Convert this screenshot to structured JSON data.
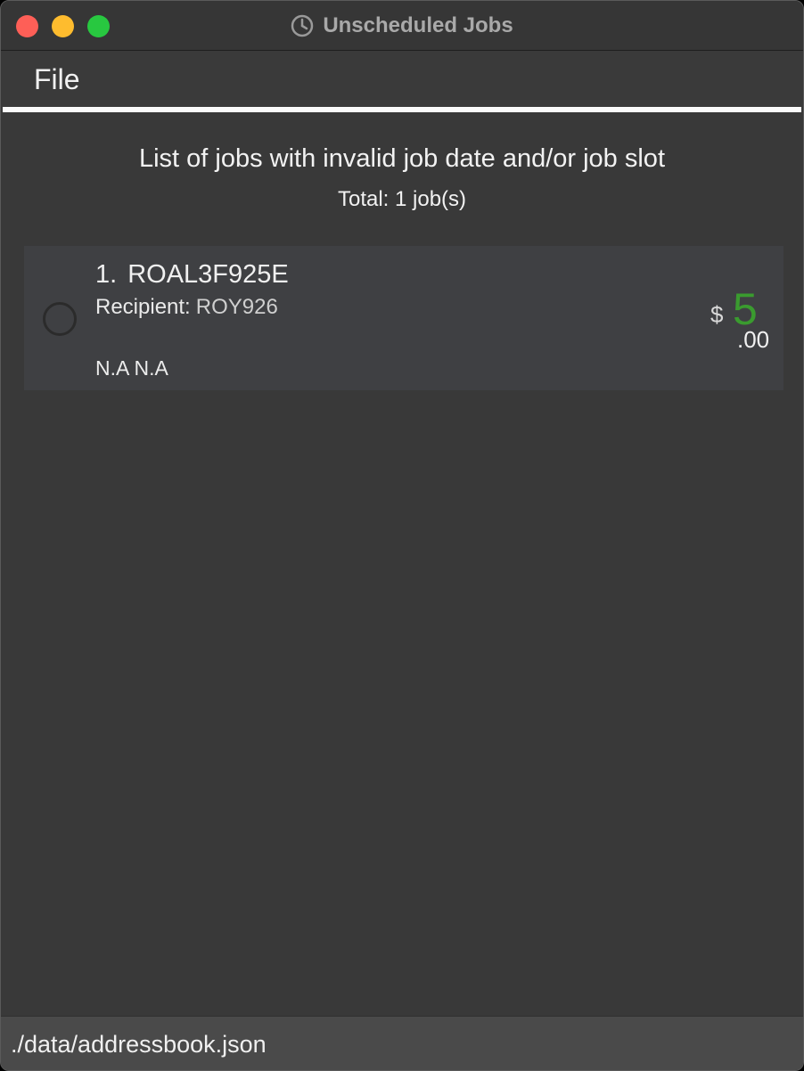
{
  "window": {
    "title": "Unscheduled Jobs",
    "title_icon": "clock-icon",
    "controls": [
      "close-button",
      "minimize-button",
      "maximize-button"
    ]
  },
  "menu": {
    "items": [
      {
        "label": "File"
      }
    ]
  },
  "main": {
    "heading": "List of jobs with invalid job date and/or job slot",
    "total": "Total: 1 job(s)",
    "jobs": [
      {
        "index": "1.",
        "id": "ROAL3F925E",
        "recipient_label": "Recipient:",
        "recipient": "ROY926",
        "address": "N.A N.A",
        "currency": "$",
        "price_whole": "5",
        "price_cents": ".00"
      }
    ]
  },
  "status_bar": {
    "path": "./data/addressbook.json"
  },
  "colors": {
    "background": "#393939",
    "price": "#3a9b2f",
    "close": "#fe5f57",
    "minimize": "#febc2e",
    "maximize": "#28c840"
  }
}
